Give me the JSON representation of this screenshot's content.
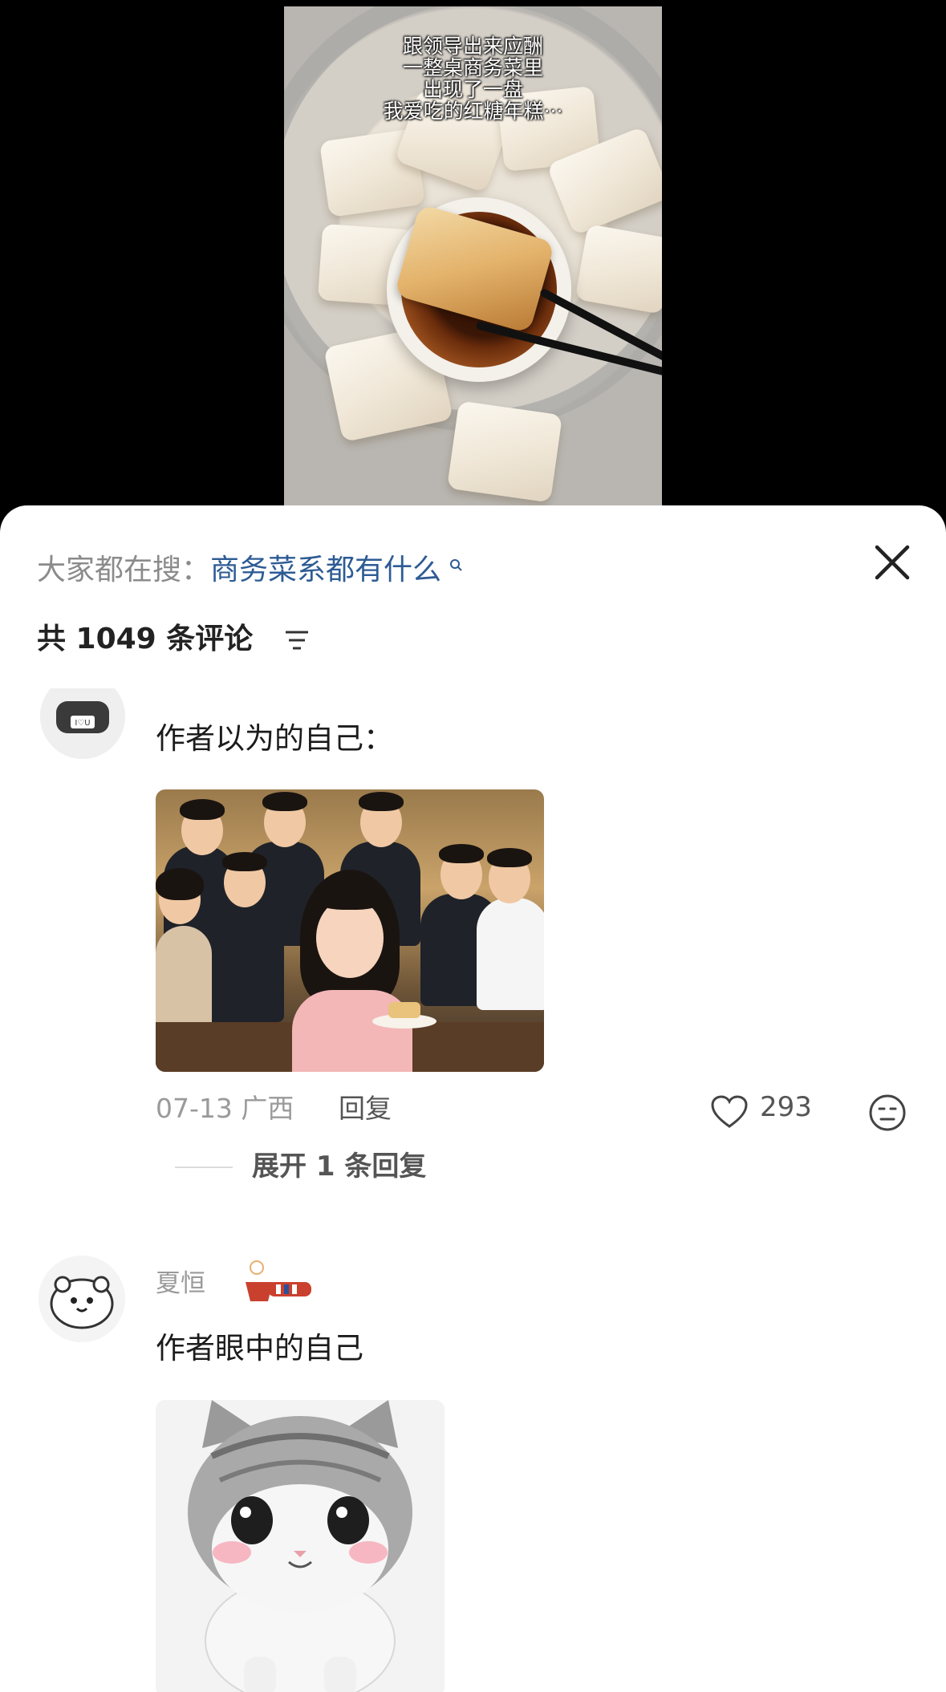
{
  "video": {
    "caption_lines": [
      "跟领导出来应酬",
      "一整桌商务菜里",
      "出现了一盘",
      "我爱吃的红糖年糕···"
    ]
  },
  "search": {
    "prefix": "大家都在搜：",
    "term": "商务菜系都有什么"
  },
  "comments_header": {
    "count_label": "共 1049 条评论"
  },
  "comments": [
    {
      "text": "作者以为的自己：",
      "date": "07-13",
      "location": "广西",
      "reply_label": "回复",
      "likes": "293",
      "expand_label": "展开 1 条回复"
    },
    {
      "username": "夏恒",
      "text": "作者眼中的自己"
    }
  ],
  "colors": {
    "search_link": "#2d5b94",
    "muted_text": "#9a9a9a"
  },
  "icons": {
    "close": "close-icon",
    "sort": "sort-icon",
    "like": "heart-icon",
    "emoji": "emoji-icon"
  }
}
